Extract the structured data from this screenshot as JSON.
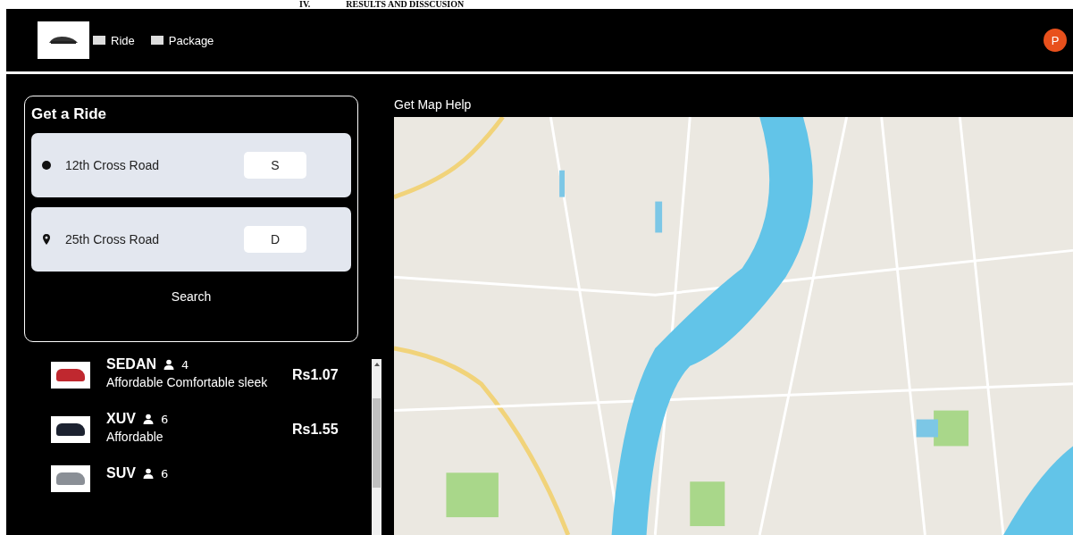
{
  "document_heading": {
    "number": "IV.",
    "title": "RESULTS AND DISSCUSION"
  },
  "header": {
    "nav": [
      {
        "label": "Ride"
      },
      {
        "label": "Package"
      }
    ],
    "avatar": "P"
  },
  "ride_panel": {
    "title": "Get a Ride",
    "locations": [
      {
        "kind": "origin",
        "value": "12th Cross Road",
        "button": "S"
      },
      {
        "kind": "destination",
        "value": "25th Cross Road",
        "button": "D"
      }
    ],
    "search_button": "Search"
  },
  "vehicles": [
    {
      "name": "SEDAN",
      "seats": "4",
      "description": "Affordable Comfortable sleek",
      "price": "Rs1.07",
      "color": "#c0282f"
    },
    {
      "name": "XUV",
      "seats": "6",
      "description": "Affordable",
      "price": "Rs1.55",
      "color": "#1c2230"
    },
    {
      "name": "SUV",
      "seats": "6",
      "color": "#8a8f96"
    }
  ],
  "map": {
    "label": "Get Map Help"
  }
}
